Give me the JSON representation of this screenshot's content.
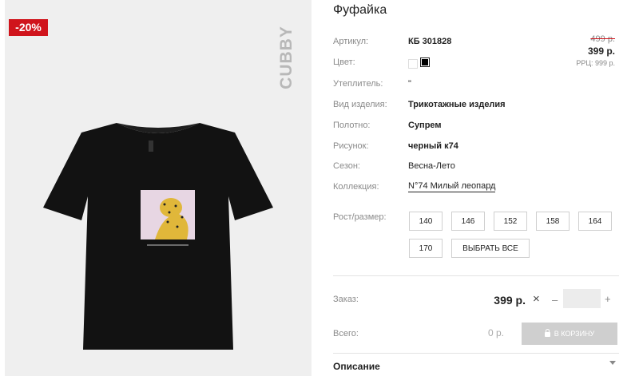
{
  "product": {
    "title": "Фуфайка",
    "discount_badge": "-20%",
    "brand": "CUBBY",
    "image_alt": "черная футболка с леопардом"
  },
  "attributes": [
    {
      "label": "Артикул:",
      "value": "КБ 301828"
    },
    {
      "label": "Цвет:",
      "value": ""
    },
    {
      "label": "Утеплитель:",
      "value": "\""
    },
    {
      "label": "Вид изделия:",
      "value": "Трикотажные изделия"
    },
    {
      "label": "Полотно:",
      "value": "Супрем"
    },
    {
      "label": "Рисунок:",
      "value": "черный к74"
    },
    {
      "label": "Сезон:",
      "value": "Весна-Лето"
    },
    {
      "label": "Коллекция:",
      "value": "N°74 Милый леопард"
    }
  ],
  "colors": [
    "#ffffff",
    "#000000"
  ],
  "price": {
    "old": "499 р.",
    "current": "399 р.",
    "rrc": "РРЦ: 999 р."
  },
  "sizes": {
    "label": "Рост/размер:",
    "options": [
      "140",
      "146",
      "152",
      "158",
      "164",
      "170"
    ],
    "select_all": "ВЫБРАТЬ ВСЕ"
  },
  "order": {
    "label": "Заказ:",
    "price": "399 р.",
    "times": "×",
    "minus": "–",
    "quantity": "",
    "plus": "+"
  },
  "total": {
    "label": "Всего:",
    "value": "0 р."
  },
  "cart_button": "В КОРЗИНУ",
  "description_title": "Описание"
}
